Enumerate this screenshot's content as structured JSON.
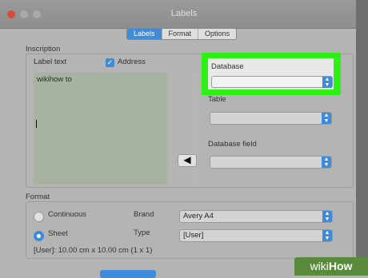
{
  "window": {
    "title": "Labels"
  },
  "tabs": [
    {
      "label": "Labels",
      "active": true
    },
    {
      "label": "Format",
      "active": false
    },
    {
      "label": "Options",
      "active": false
    }
  ],
  "inscription": {
    "group_label": "Inscription",
    "label_text_label": "Label text",
    "address_label": "Address",
    "address_checked": true,
    "text_lines": [
      "wikihow to"
    ]
  },
  "database": {
    "label": "Database",
    "value": "",
    "table_label": "Table",
    "table_value": "",
    "field_label": "Database field",
    "field_value": "",
    "insert_icon": "arrow-left-icon",
    "highlight_color": "#2ff015"
  },
  "format": {
    "group_label": "Format",
    "continuous_label": "Continuous",
    "sheet_label": "Sheet",
    "selected": "Sheet",
    "brand_label": "Brand",
    "brand_value": "Avery A4",
    "type_label": "Type",
    "type_value": "[User]",
    "size_info": "[User]: 10.00 cm x 10.00 cm (1 x 1)"
  },
  "accent_color": "#3d8bd9",
  "watermark": {
    "wiki": "wiki",
    "how": "How"
  }
}
